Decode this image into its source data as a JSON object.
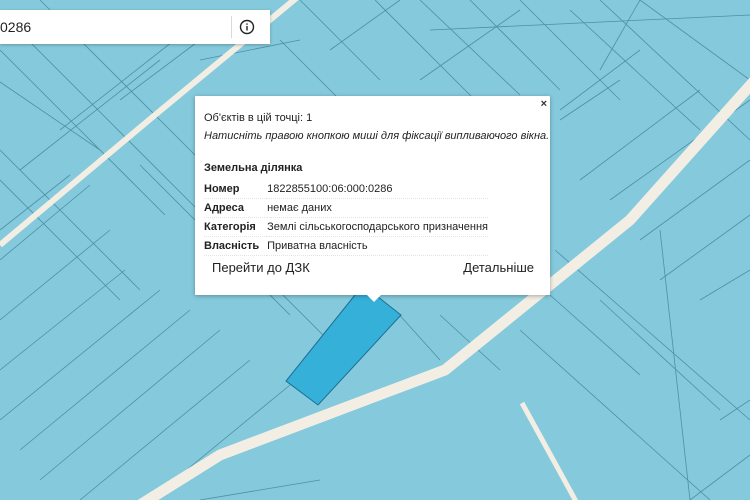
{
  "map": {
    "colors": {
      "parcel_fill": "#85c9dc",
      "parcel_border": "#4e8fa6",
      "road": "#f2eee4",
      "highlight_fill": "#35b0d9",
      "highlight_border": "#1c6f91"
    }
  },
  "search": {
    "value": "0286",
    "info_icon": "info-icon"
  },
  "popup": {
    "objects_count": "Об'єктів в цій точці: 1",
    "hint": "Натисніть правою кнопкою миші для фіксації випливаючого вікна.",
    "close_label": "×",
    "parcel_title": "Земельна ділянка",
    "fields": [
      {
        "label": "Номер",
        "value": "1822855100:06:000:0286"
      },
      {
        "label": "Адреса",
        "value": "немає даних"
      },
      {
        "label": "Категорія",
        "value": "Землі сільськогосподарського призначення"
      },
      {
        "label": "Власність",
        "value": "Приватна власність"
      }
    ],
    "link_dzk": "Перейти до ДЗК",
    "link_details": "Детальніше"
  }
}
